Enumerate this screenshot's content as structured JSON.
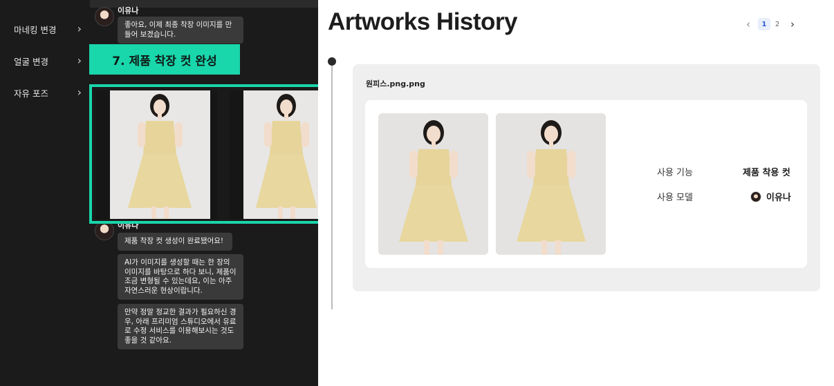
{
  "sidebar": {
    "items": [
      {
        "label": "마네킹 변경"
      },
      {
        "label": "얼굴 변경"
      },
      {
        "label": "자유 포즈"
      }
    ]
  },
  "chat": {
    "sender_name": "이유나",
    "message_1": "좋아요, 이제 최종 착장 이미지를 만들어 보겠습니다.",
    "message_2": "제품 착장 컷 생성이 완료됐어요!",
    "message_3": "AI가 이미지를 생성할 때는 한 장의 이미지를 바탕으로 하다 보니, 제품이 조금 변형될 수 있는데요, 이는 아주 자연스러운 현상이랍니다.",
    "message_4": "만약 정말 정교한 결과가 필요하신 경우, 아래 프리미엄 스튜디오에서 유료로 수정 서비스를 이용해보시는 것도 좋을 것 같아요."
  },
  "annotation": {
    "step_label": "7. 제품 착장 컷 완성",
    "accent_color": "#19d6ab"
  },
  "main": {
    "title": "Artworks History",
    "pagination": {
      "pages": [
        "1",
        "2"
      ],
      "current": "1"
    },
    "card": {
      "filename": "원피스.png.png",
      "meta": [
        {
          "key": "사용 기능",
          "value": "제품 착용 컷"
        },
        {
          "key": "사용 모델",
          "value": "이유나"
        }
      ]
    }
  },
  "icons": {
    "sidebar_chevron": "chevron-right-icon",
    "pager_prev": "chevron-left-icon",
    "pager_next": "chevron-right-icon"
  }
}
